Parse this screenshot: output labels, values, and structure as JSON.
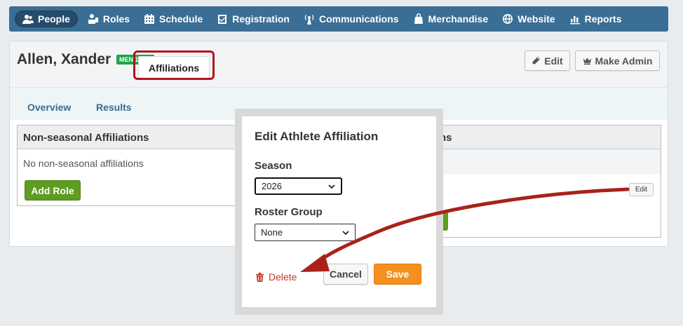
{
  "nav": {
    "items": [
      {
        "label": "People",
        "icon": "people-icon",
        "active": true
      },
      {
        "label": "Roles",
        "icon": "roles-icon"
      },
      {
        "label": "Schedule",
        "icon": "calendar-icon"
      },
      {
        "label": "Registration",
        "icon": "checkbox-icon"
      },
      {
        "label": "Communications",
        "icon": "broadcast-icon"
      },
      {
        "label": "Merchandise",
        "icon": "bag-icon"
      },
      {
        "label": "Website",
        "icon": "globe-icon"
      },
      {
        "label": "Reports",
        "icon": "bar-chart-icon"
      }
    ]
  },
  "profile": {
    "name": "Allen, Xander",
    "badge": "MEN 15-18",
    "edit_label": "Edit",
    "make_admin_label": "Make Admin"
  },
  "tabs": {
    "overview": "Overview",
    "results": "Results",
    "affiliations": "Affiliations"
  },
  "non_seasonal": {
    "title": "Non-seasonal Affiliations",
    "empty": "No non-seasonal affiliations",
    "add_role": "Add Role"
  },
  "seasonal": {
    "title_fragment": "ns",
    "edit_label": "Edit"
  },
  "modal": {
    "title": "Edit Athlete Affiliation",
    "season_label": "Season",
    "season_value": "2026",
    "roster_label": "Roster Group",
    "roster_value": "None",
    "delete_label": "Delete",
    "cancel_label": "Cancel",
    "save_label": "Save"
  },
  "colors": {
    "nav_bg": "#3b6e95",
    "badge": "#1ea44b",
    "green_button": "#5e9c22",
    "save": "#f5901e",
    "delete": "#c0392b",
    "highlight": "#b3141c"
  }
}
